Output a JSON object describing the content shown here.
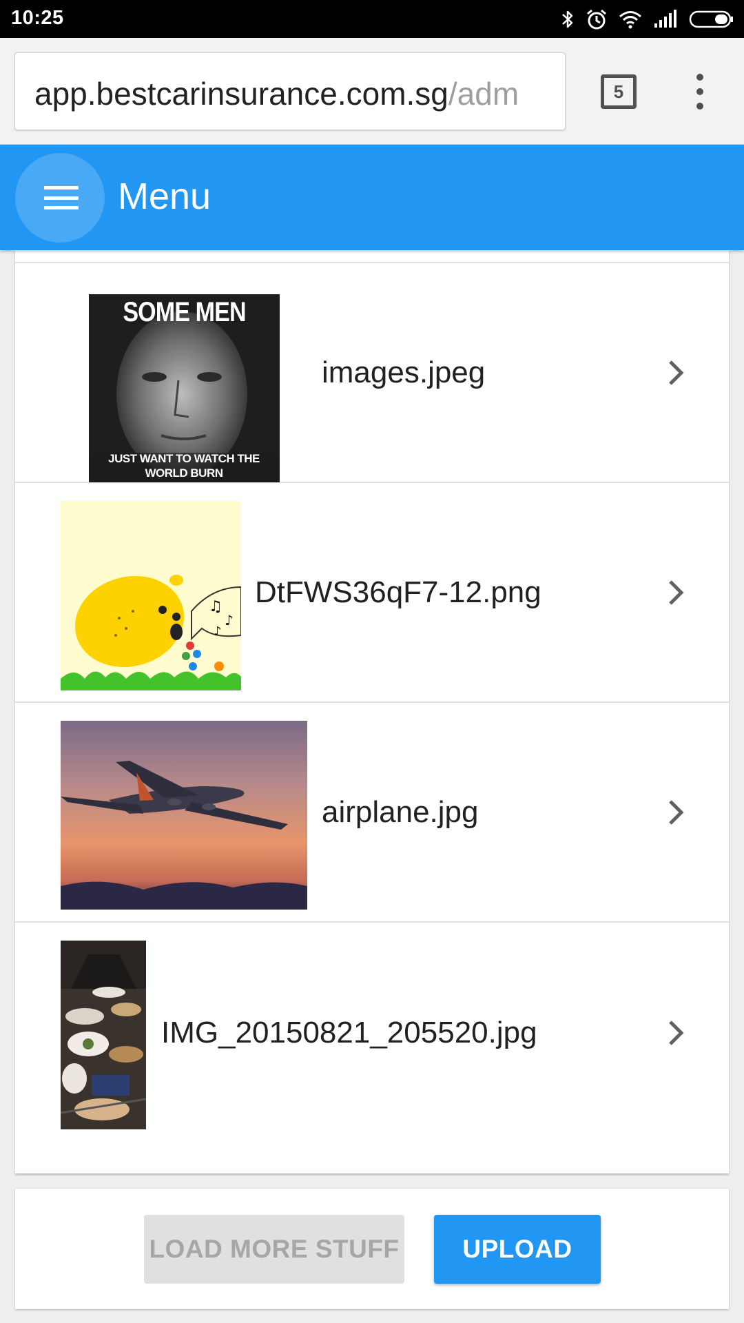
{
  "status_bar": {
    "time": "10:25",
    "icons": [
      "bluetooth-icon",
      "alarm-icon",
      "wifi-icon",
      "signal-icon",
      "battery-icon"
    ]
  },
  "browser": {
    "url_host": "app.bestcarinsurance.com.sg",
    "url_path": "/adm",
    "tab_count": "5",
    "overflow_icon": "more-vert-icon"
  },
  "app_bar": {
    "title": "Menu",
    "menu_icon": "hamburger-icon",
    "color": "#2196f3"
  },
  "files": [
    {
      "name": "images.jpeg",
      "thumb_caption_top": "SOME MEN",
      "thumb_caption_bottom": "JUST WANT TO WATCH THE WORLD BURN"
    },
    {
      "name": "DtFWS36qF7-12.png"
    },
    {
      "name": "airplane.jpg"
    },
    {
      "name": "IMG_20150821_205520.jpg"
    }
  ],
  "actions": {
    "load_more_label": "LOAD MORE STUFF",
    "upload_label": "UPLOAD"
  }
}
